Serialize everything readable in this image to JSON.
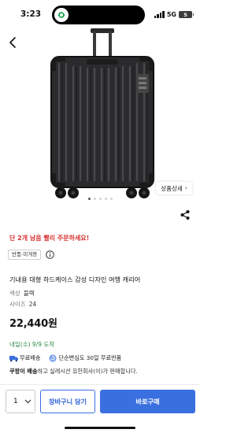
{
  "status_bar": {
    "time": "3:23",
    "network": "5G",
    "battery": "5"
  },
  "gallery": {
    "detail_label": "상품상세",
    "detail_arrow": "›",
    "dot_count": 5,
    "active_dot": 0
  },
  "product": {
    "stock_alert": "단 2개 남음 빨리 주문하세요!",
    "policy_badge": "반품-미개봉",
    "title": "기내용 대형 하드케이스 감성 디자인 여행 캐리어",
    "options": [
      {
        "key": "색상",
        "value": "블랙"
      },
      {
        "key": "사이즈",
        "value": "24"
      }
    ],
    "price": "22,440원",
    "delivery_date": "내일(수) 9/9 도착",
    "shipping": {
      "free_label": "무료배송",
      "return_label": "단순변심도 30일 무료반품"
    },
    "seller_strong": "쿠팡이 배송",
    "seller_rest": "하고 실레시션 유한회사(이)가 판매합니다."
  },
  "bottom_bar": {
    "quantity": "1",
    "cart_label": "장바구니 담기",
    "buy_label": "바로구매"
  },
  "colors": {
    "accent": "#3a6fe0",
    "alert": "#d73232",
    "delivery": "#2e8a43"
  }
}
